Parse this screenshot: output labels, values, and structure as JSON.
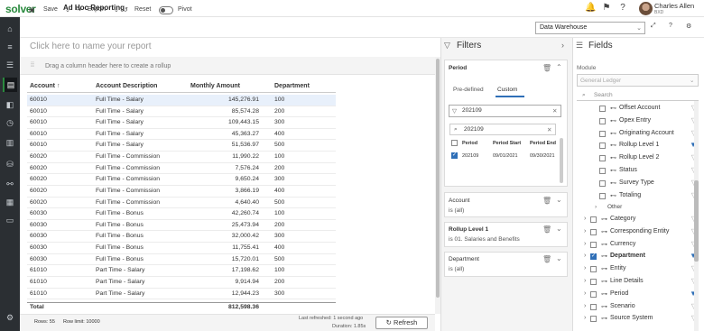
{
  "header": {
    "logo": "solver",
    "title": "Ad Hoc Reporting",
    "user_name": "Charles Allen",
    "user_org": "BXD"
  },
  "toolbar": {
    "save": "Save",
    "export": "Export",
    "reset": "Reset",
    "pivot": "Pivot",
    "data_source": "Data Warehouse"
  },
  "report": {
    "title_placeholder": "Click here to name your report",
    "rollup_hint": "Drag a column header here to create a rollup",
    "columns": [
      "Account",
      "Account Description",
      "Monthly Amount",
      "Department"
    ],
    "rows": [
      [
        "60010",
        "Full Time - Salary",
        "145,276.91",
        "100"
      ],
      [
        "60010",
        "Full Time - Salary",
        "85,574.28",
        "200"
      ],
      [
        "60010",
        "Full Time - Salary",
        "109,443.15",
        "300"
      ],
      [
        "60010",
        "Full Time - Salary",
        "45,363.27",
        "400"
      ],
      [
        "60010",
        "Full Time - Salary",
        "51,536.97",
        "500"
      ],
      [
        "60020",
        "Full Time - Commission",
        "11,990.22",
        "100"
      ],
      [
        "60020",
        "Full Time - Commission",
        "7,576.24",
        "200"
      ],
      [
        "60020",
        "Full Time - Commission",
        "9,650.24",
        "300"
      ],
      [
        "60020",
        "Full Time - Commission",
        "3,866.19",
        "400"
      ],
      [
        "60020",
        "Full Time - Commission",
        "4,640.40",
        "500"
      ],
      [
        "60030",
        "Full Time - Bonus",
        "42,260.74",
        "100"
      ],
      [
        "60030",
        "Full Time - Bonus",
        "25,473.94",
        "200"
      ],
      [
        "60030",
        "Full Time - Bonus",
        "32,000.42",
        "300"
      ],
      [
        "60030",
        "Full Time - Bonus",
        "11,755.41",
        "400"
      ],
      [
        "60030",
        "Full Time - Bonus",
        "15,720.01",
        "500"
      ],
      [
        "61010",
        "Part Time - Salary",
        "17,198.62",
        "100"
      ],
      [
        "61010",
        "Part Time - Salary",
        "9,914.94",
        "200"
      ],
      [
        "61010",
        "Part Time - Salary",
        "12,944.23",
        "300"
      ]
    ],
    "total_label": "Total",
    "total_value": "812,598.36",
    "rows_count": "Rows: 55",
    "row_limit": "Row limit: 10000",
    "last_refreshed": "Last refreshed: 1 second ago",
    "duration": "Duration: 1.85s",
    "refresh": "Refresh"
  },
  "filters": {
    "title": "Filters",
    "period": {
      "title": "Period",
      "tab_predefined": "Pre-defined",
      "tab_custom": "Custom",
      "filter_value": "202109",
      "search_value": "202109",
      "col_period": "Period",
      "col_start": "Period Start",
      "col_end": "Period End",
      "row_period": "202109",
      "row_start": "09/01/2021",
      "row_end": "09/30/2021"
    },
    "account": {
      "title": "Account",
      "value": "is (all)"
    },
    "rollup1": {
      "title": "Rollup Level 1",
      "value": "is 01. Salaries and Benefits"
    },
    "department": {
      "title": "Department",
      "value": "is (all)"
    }
  },
  "fields": {
    "title": "Fields",
    "module_label": "Module",
    "module_value": "General Ledger",
    "search_placeholder": "Search",
    "sub_items": [
      {
        "label": "Offset Account",
        "checked": false,
        "filter": false
      },
      {
        "label": "Opex Entry",
        "checked": false,
        "filter": false
      },
      {
        "label": "Originating Account",
        "checked": false,
        "filter": false
      },
      {
        "label": "Rollup Level 1",
        "checked": false,
        "filter": true
      },
      {
        "label": "Rollup Level 2",
        "checked": false,
        "filter": false
      },
      {
        "label": "Status",
        "checked": false,
        "filter": false
      },
      {
        "label": "Survey Type",
        "checked": false,
        "filter": false
      },
      {
        "label": "Totaling",
        "checked": false,
        "filter": false
      }
    ],
    "other_label": "Other",
    "groups": [
      {
        "label": "Category",
        "checked": false,
        "filter": false,
        "bold": false
      },
      {
        "label": "Corresponding Entity",
        "checked": false,
        "filter": false,
        "bold": false
      },
      {
        "label": "Currency",
        "checked": false,
        "filter": false,
        "bold": false
      },
      {
        "label": "Department",
        "checked": true,
        "filter": true,
        "bold": true
      },
      {
        "label": "Entity",
        "checked": false,
        "filter": false,
        "bold": false
      },
      {
        "label": "Line Details",
        "checked": false,
        "filter": false,
        "bold": false
      },
      {
        "label": "Period",
        "checked": false,
        "filter": true,
        "bold": false
      },
      {
        "label": "Scenario",
        "checked": false,
        "filter": false,
        "bold": false
      },
      {
        "label": "Source System",
        "checked": false,
        "filter": false,
        "bold": false
      }
    ]
  },
  "colors": {
    "accent": "#2f6fb7",
    "brand": "#2a8a3e",
    "nav": "#2b2f33"
  }
}
